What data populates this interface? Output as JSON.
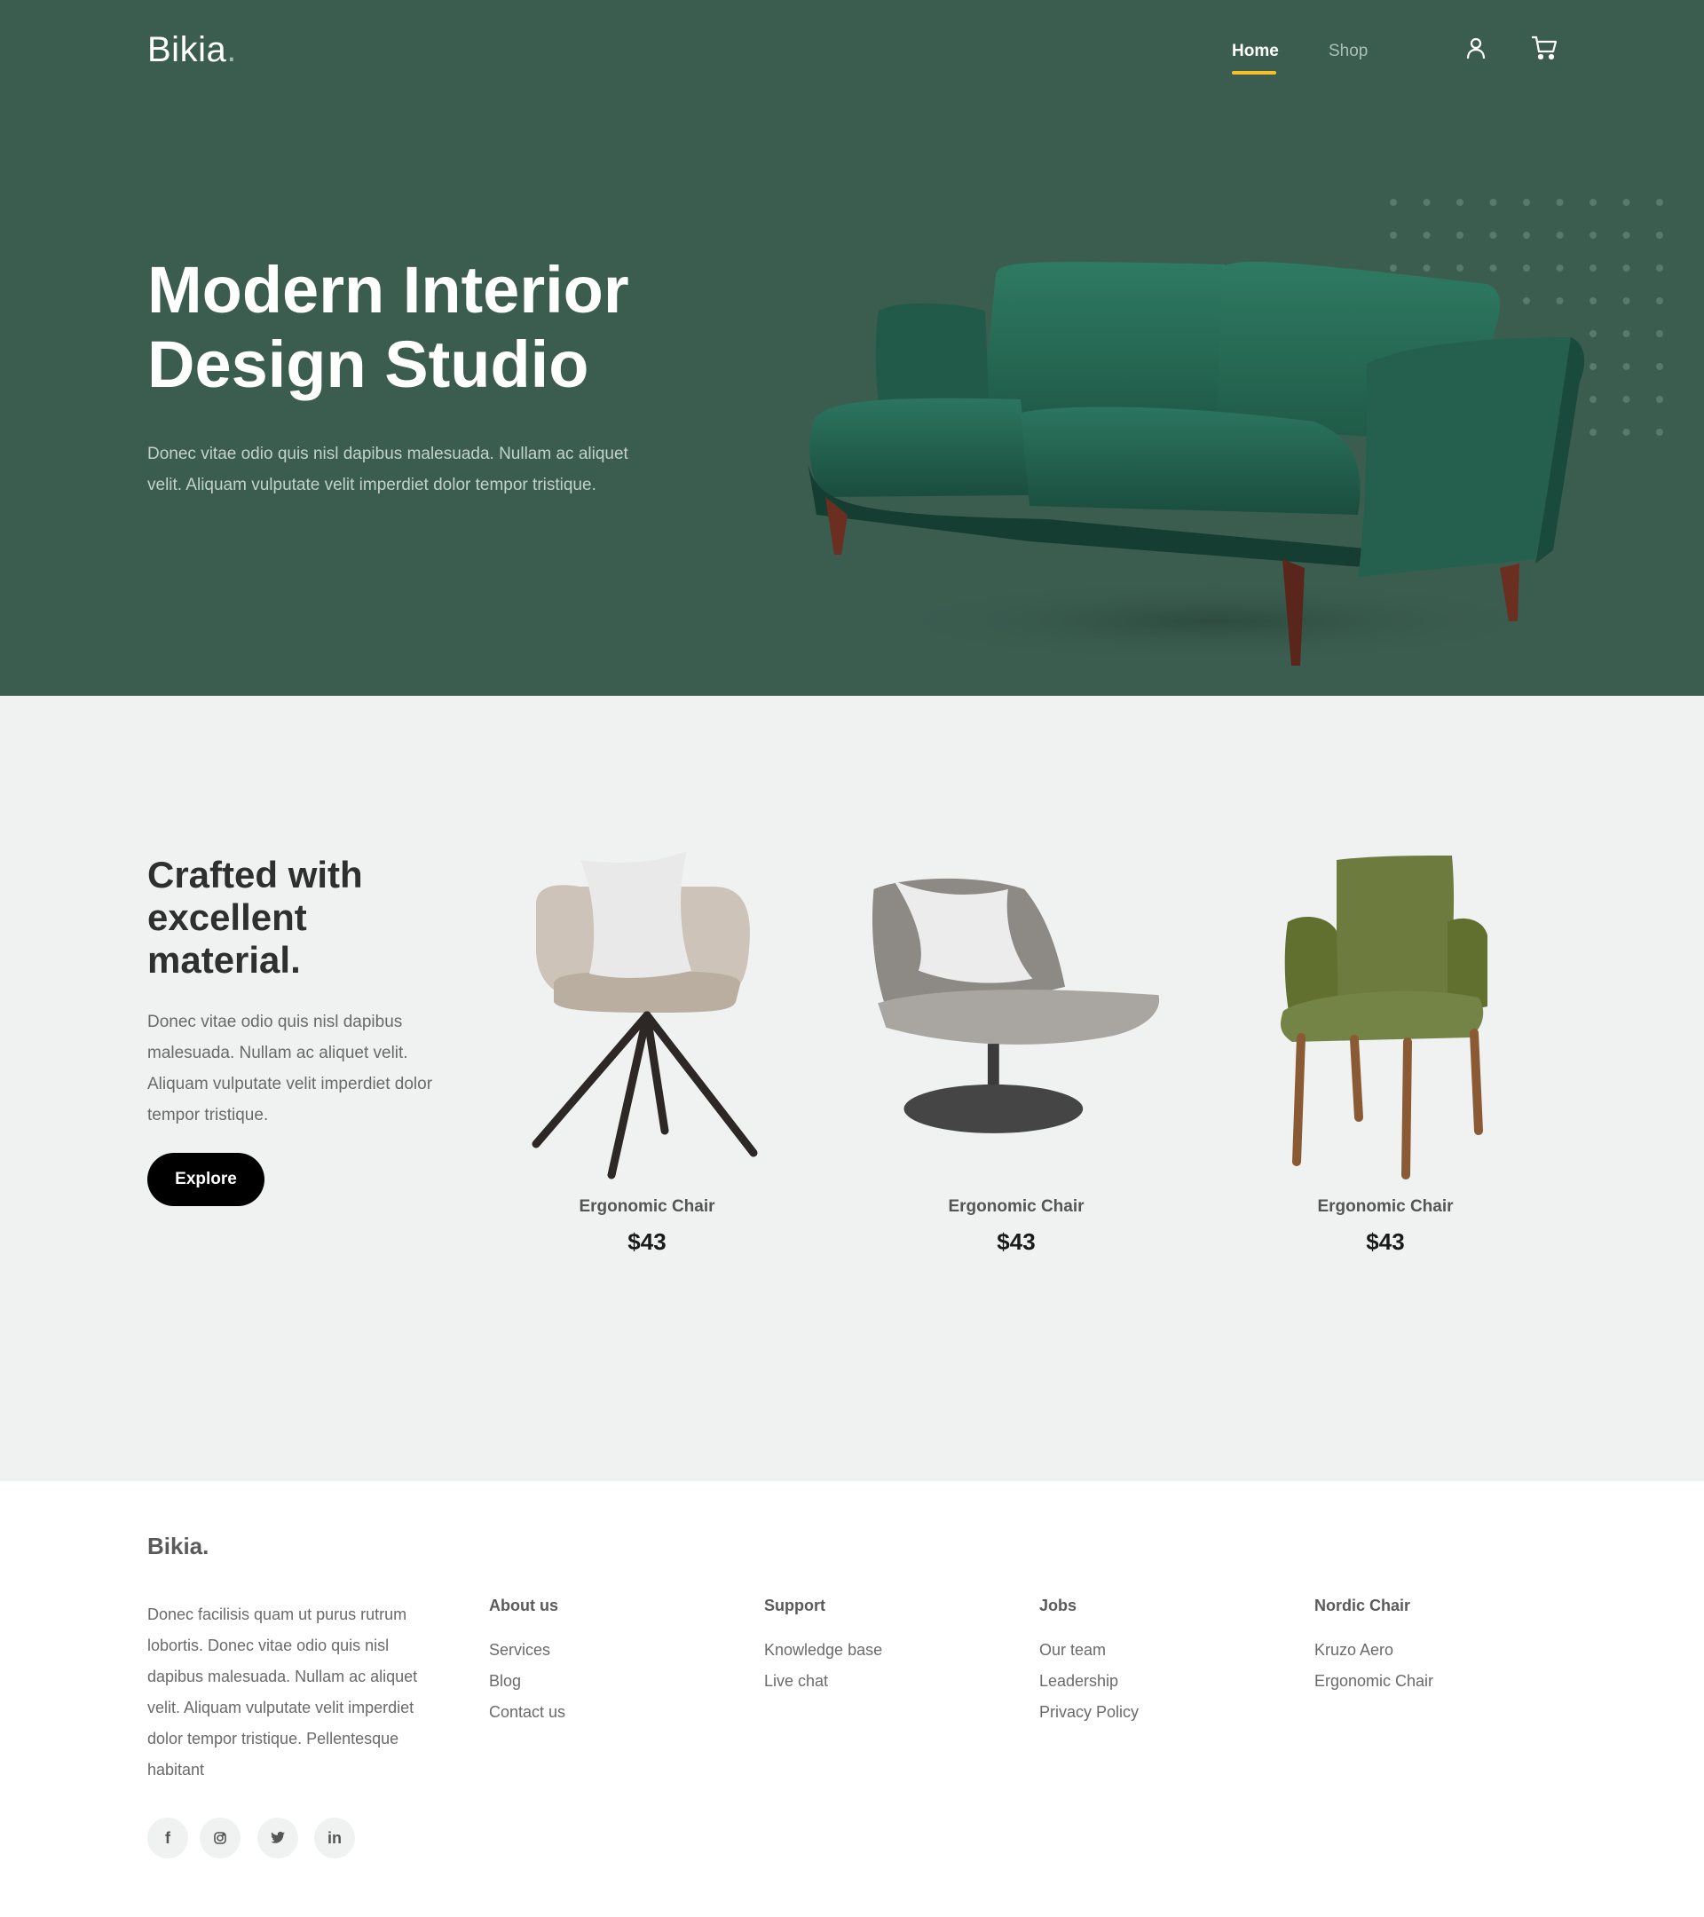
{
  "brand": {
    "name": "Bikia",
    "dot": ".",
    "accent": "#f9bf29",
    "hero_bg": "#3b5d50"
  },
  "nav": {
    "home": "Home",
    "shop": "Shop",
    "icons": [
      "user-icon",
      "cart-icon"
    ]
  },
  "hero": {
    "title_line1": "Modern Interior",
    "title_line2": "Design Studio",
    "description": "Donec vitae odio quis nisl dapibus malesuada. Nullam ac aliquet velit. Aliquam vulputate velit imperdiet dolor tempor tristique."
  },
  "products_section": {
    "heading_line1": "Crafted with",
    "heading_line2": "excellent",
    "heading_line3": "material.",
    "description": "Donec vitae odio quis nisl dapibus malesuada. Nullam ac aliquet velit. Aliquam vulputate velit imperdiet dolor tempor tristique.",
    "button": "Explore",
    "items": [
      {
        "name": "Ergonomic Chair",
        "price": "$43"
      },
      {
        "name": "Ergonomic Chair",
        "price": "$43"
      },
      {
        "name": "Ergonomic Chair",
        "price": "$43"
      }
    ]
  },
  "footer": {
    "logo": "Bikia.",
    "description": "Donec facilisis quam ut purus rutrum lobortis. Donec vitae odio quis nisl dapibus malesuada. Nullam ac aliquet velit. Aliquam vulputate velit imperdiet dolor tempor tristique. Pellentesque habitant",
    "columns": [
      {
        "title": "About us",
        "links": [
          "Services",
          "Blog",
          "Contact us"
        ]
      },
      {
        "title": "Support",
        "links": [
          "Knowledge base",
          "Live chat"
        ]
      },
      {
        "title": "Jobs",
        "links": [
          "Our team",
          "Leadership",
          "Privacy Policy"
        ]
      },
      {
        "title": "Nordic Chair",
        "links": [
          "Kruzo Aero",
          "Ergonomic Chair"
        ]
      }
    ],
    "social": [
      "facebook-icon",
      "instagram-icon",
      "twitter-icon",
      "linkedin-icon"
    ],
    "social_labels": {
      "facebook": "f",
      "linkedin": "in"
    }
  }
}
